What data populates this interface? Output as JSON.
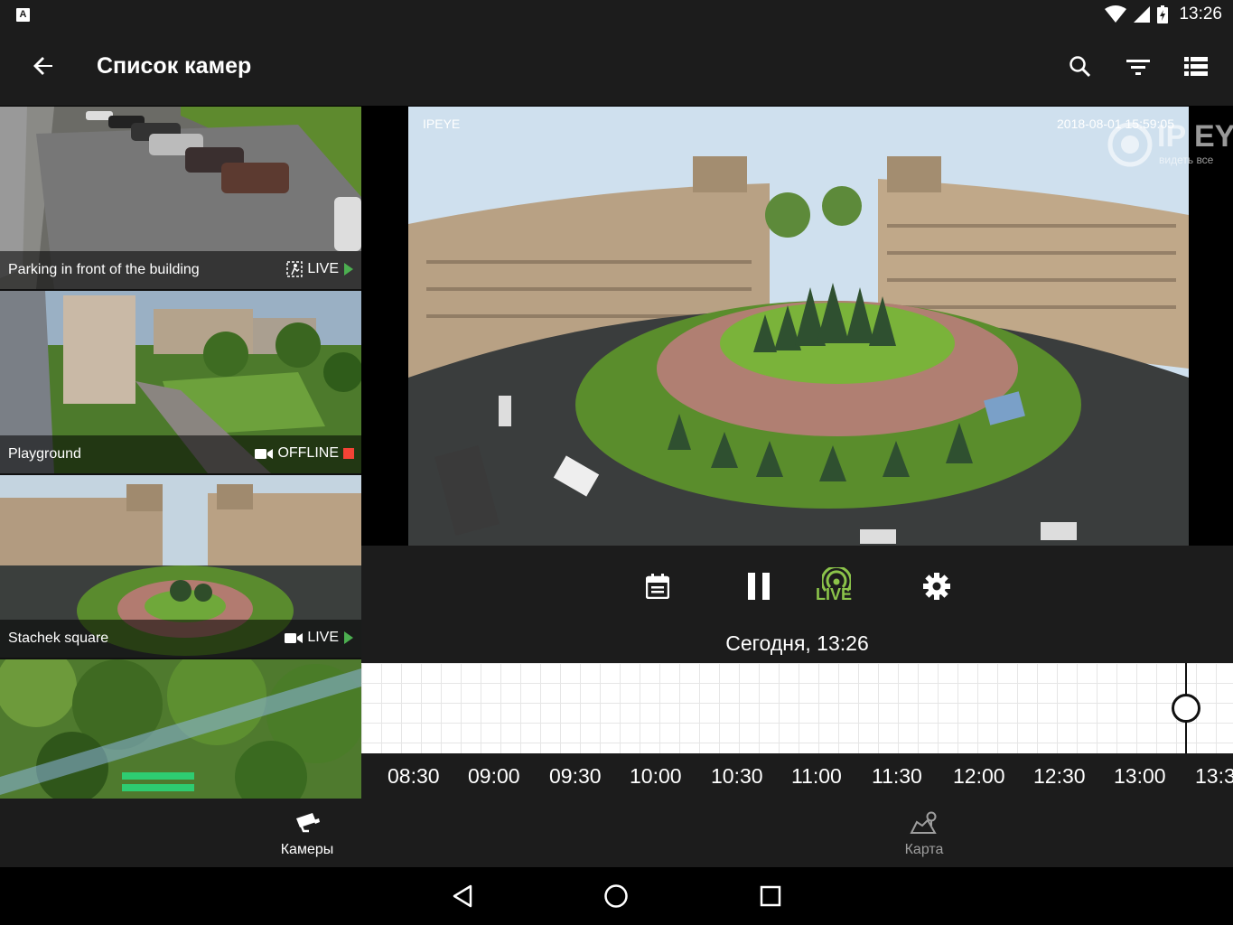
{
  "status_bar": {
    "app_icon_letter": "A",
    "time": "13:26"
  },
  "app_bar": {
    "title": "Список камер",
    "back_icon": "arrow-back-icon",
    "actions": [
      "search-icon",
      "filter-icon",
      "list-view-icon"
    ]
  },
  "cameras": [
    {
      "name": "Parking in front of the building",
      "status": "LIVE",
      "status_icon": "motion-icon",
      "indicator_color": "#4caf50"
    },
    {
      "name": "Playground",
      "status": "OFFLINE",
      "status_icon": "videocam-icon",
      "indicator_color": "#f44336"
    },
    {
      "name": "Stachek square",
      "status": "LIVE",
      "status_icon": "videocam-icon",
      "indicator_color": "#4caf50"
    },
    {
      "name": "",
      "status": "",
      "status_icon": "",
      "indicator_color": ""
    }
  ],
  "player": {
    "overlay_label": "IPEYE",
    "overlay_timestamp": "2018-08-01 15:59:05",
    "logo_text": "IP EYE",
    "logo_subtext": "видеть все"
  },
  "controls": {
    "live_label": "LIVE",
    "live_color": "#8bc34a",
    "date_label": "Сегодня, 13:26"
  },
  "timeline": {
    "ticks": [
      "08:30",
      "09:00",
      "09:30",
      "10:00",
      "10:30",
      "11:00",
      "11:30",
      "12:00",
      "12:30",
      "13:00",
      "13:3"
    ]
  },
  "bottom_nav": {
    "items": [
      {
        "label": "Камеры",
        "icon": "cctv-camera-icon",
        "active": true
      },
      {
        "label": "Карта",
        "icon": "map-icon",
        "active": false
      }
    ]
  },
  "colors": {
    "bar_bg": "#1c1c1c",
    "accent_green": "#8bc34a",
    "offline_red": "#f44336",
    "live_green": "#4caf50"
  }
}
